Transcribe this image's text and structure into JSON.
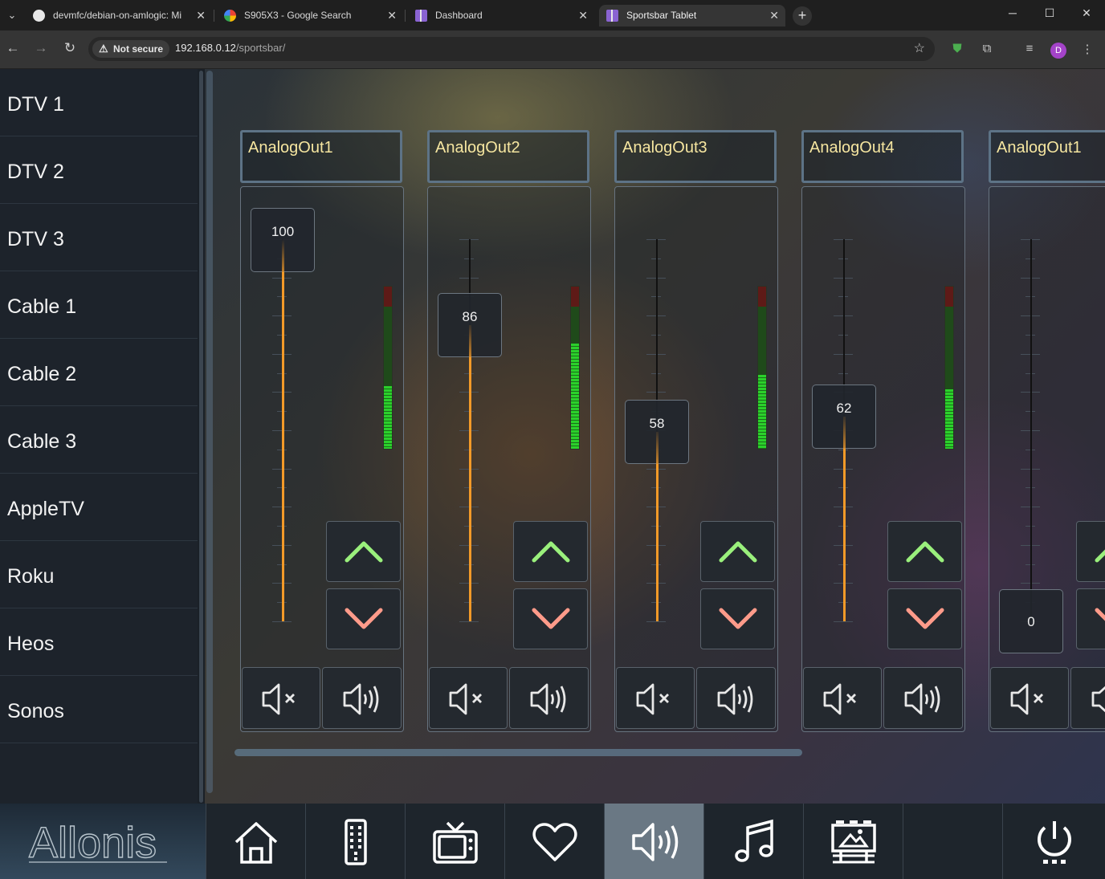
{
  "browser": {
    "tabs": [
      {
        "title": "devmfc/debian-on-amlogic: Mi",
        "icon": "github-icon",
        "active": false
      },
      {
        "title": "S905X3 - Google Search",
        "icon": "google-icon",
        "active": false
      },
      {
        "title": "Dashboard",
        "icon": "dashboard-icon",
        "active": false
      },
      {
        "title": "Sportsbar Tablet",
        "icon": "sportsbar-icon",
        "active": true
      }
    ],
    "security_label": "Not secure",
    "url_host": "192.168.0.12",
    "url_path": "/sportsbar/",
    "profile_initial": "D"
  },
  "sidebar": {
    "items": [
      {
        "label": "DTV 1"
      },
      {
        "label": "DTV 2"
      },
      {
        "label": "DTV 3"
      },
      {
        "label": "Cable 1"
      },
      {
        "label": "Cable 2"
      },
      {
        "label": "Cable 3"
      },
      {
        "label": "AppleTV"
      },
      {
        "label": "Roku"
      },
      {
        "label": "Heos"
      },
      {
        "label": "Sonos"
      }
    ]
  },
  "logo_text": "Allonis",
  "mixer": {
    "accent_color": "#f39a28",
    "meter_color": "#2bd12b",
    "channels": [
      {
        "name": "AnalogOut1",
        "volume": 100,
        "meter_level": 0.44
      },
      {
        "name": "AnalogOut2",
        "volume": 86,
        "meter_level": 0.74
      },
      {
        "name": "AnalogOut3",
        "volume": 58,
        "meter_level": 0.52
      },
      {
        "name": "AnalogOut4",
        "volume": 62,
        "meter_level": 0.42
      },
      {
        "name": "AnalogOut1",
        "volume": 0,
        "meter_level": 0
      }
    ]
  },
  "bottom_nav": {
    "items": [
      {
        "icon": "home-icon",
        "active": false
      },
      {
        "icon": "remote-icon",
        "active": false
      },
      {
        "icon": "tv-icon",
        "active": false
      },
      {
        "icon": "heart-icon",
        "active": false
      },
      {
        "icon": "speaker-icon",
        "active": true
      },
      {
        "icon": "music-note-icon",
        "active": false
      },
      {
        "icon": "billboard-icon",
        "active": false
      },
      {
        "icon": "",
        "active": false
      },
      {
        "icon": "power-icon",
        "active": false
      }
    ]
  }
}
